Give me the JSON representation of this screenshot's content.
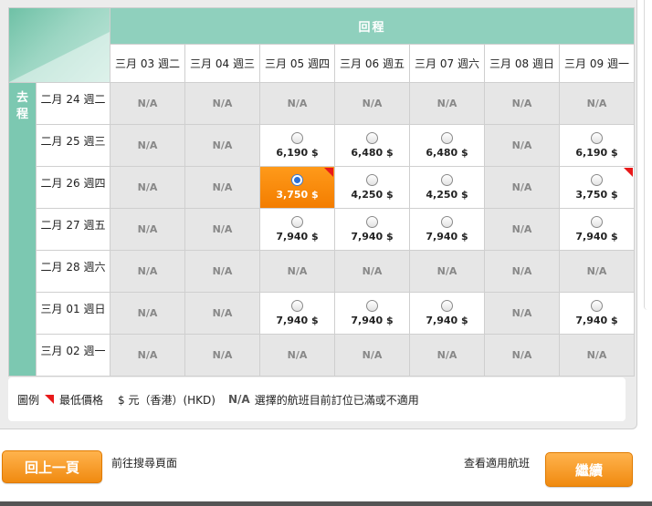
{
  "header": {
    "return_label": "回程"
  },
  "depart_label": [
    "去",
    "程"
  ],
  "return_dates": [
    "三月 03 週二",
    "三月 04 週三",
    "三月 05 週四",
    "三月 06 週五",
    "三月 07 週六",
    "三月 08 週日",
    "三月 09 週一"
  ],
  "rows": [
    {
      "date": "二月 24 週二",
      "cells": [
        {
          "status": "na",
          "text": "N/A"
        },
        {
          "status": "na",
          "text": "N/A"
        },
        {
          "status": "na",
          "text": "N/A"
        },
        {
          "status": "na",
          "text": "N/A"
        },
        {
          "status": "na",
          "text": "N/A"
        },
        {
          "status": "na",
          "text": "N/A"
        },
        {
          "status": "na",
          "text": "N/A"
        }
      ]
    },
    {
      "date": "二月 25 週三",
      "cells": [
        {
          "status": "na",
          "text": "N/A"
        },
        {
          "status": "na",
          "text": "N/A"
        },
        {
          "status": "avail",
          "text": "6,190 $"
        },
        {
          "status": "avail",
          "text": "6,480 $"
        },
        {
          "status": "avail",
          "text": "6,480 $"
        },
        {
          "status": "na",
          "text": "N/A"
        },
        {
          "status": "avail",
          "text": "6,190 $"
        }
      ]
    },
    {
      "date": "二月 26 週四",
      "cells": [
        {
          "status": "na",
          "text": "N/A"
        },
        {
          "status": "na",
          "text": "N/A"
        },
        {
          "status": "selected",
          "text": "3,750 $",
          "lowest": true
        },
        {
          "status": "avail",
          "text": "4,250 $"
        },
        {
          "status": "avail",
          "text": "4,250 $"
        },
        {
          "status": "na",
          "text": "N/A"
        },
        {
          "status": "avail",
          "text": "3,750 $",
          "lowest": true
        }
      ]
    },
    {
      "date": "二月 27 週五",
      "cells": [
        {
          "status": "na",
          "text": "N/A"
        },
        {
          "status": "na",
          "text": "N/A"
        },
        {
          "status": "avail",
          "text": "7,940 $"
        },
        {
          "status": "avail",
          "text": "7,940 $"
        },
        {
          "status": "avail",
          "text": "7,940 $"
        },
        {
          "status": "na",
          "text": "N/A"
        },
        {
          "status": "avail",
          "text": "7,940 $"
        }
      ]
    },
    {
      "date": "二月 28 週六",
      "cells": [
        {
          "status": "na",
          "text": "N/A"
        },
        {
          "status": "na",
          "text": "N/A"
        },
        {
          "status": "na",
          "text": "N/A"
        },
        {
          "status": "na",
          "text": "N/A"
        },
        {
          "status": "na",
          "text": "N/A"
        },
        {
          "status": "na",
          "text": "N/A"
        },
        {
          "status": "na",
          "text": "N/A"
        }
      ]
    },
    {
      "date": "三月 01 週日",
      "cells": [
        {
          "status": "na",
          "text": "N/A"
        },
        {
          "status": "na",
          "text": "N/A"
        },
        {
          "status": "avail",
          "text": "7,940 $"
        },
        {
          "status": "avail",
          "text": "7,940 $"
        },
        {
          "status": "avail",
          "text": "7,940 $"
        },
        {
          "status": "na",
          "text": "N/A"
        },
        {
          "status": "avail",
          "text": "7,940 $"
        }
      ]
    },
    {
      "date": "三月 02 週一",
      "cells": [
        {
          "status": "na",
          "text": "N/A"
        },
        {
          "status": "na",
          "text": "N/A"
        },
        {
          "status": "na",
          "text": "N/A"
        },
        {
          "status": "na",
          "text": "N/A"
        },
        {
          "status": "na",
          "text": "N/A"
        },
        {
          "status": "na",
          "text": "N/A"
        },
        {
          "status": "na",
          "text": "N/A"
        }
      ]
    }
  ],
  "legend": {
    "label": "圖例",
    "lowest_price": "最低價格",
    "currency": "$ 元（香港）(HKD)",
    "na_code": "N/A",
    "na_desc": "選擇的航班目前訂位已滿或不適用"
  },
  "footer": {
    "back_button": "回上一頁",
    "back_desc": "前往搜尋頁面",
    "view_flights": "查看適用航班",
    "continue_button": "繼續"
  },
  "colors": {
    "header_green": "#8fd0bd",
    "depart_green": "#7cc8b1",
    "selected_orange": "#f37d00",
    "lowest_flag_red": "#e8191a",
    "button_orange": "#f08a10"
  },
  "icons": {
    "lowest_price_flag": "red-corner-flag-icon",
    "fare_select": "radio-icon"
  }
}
